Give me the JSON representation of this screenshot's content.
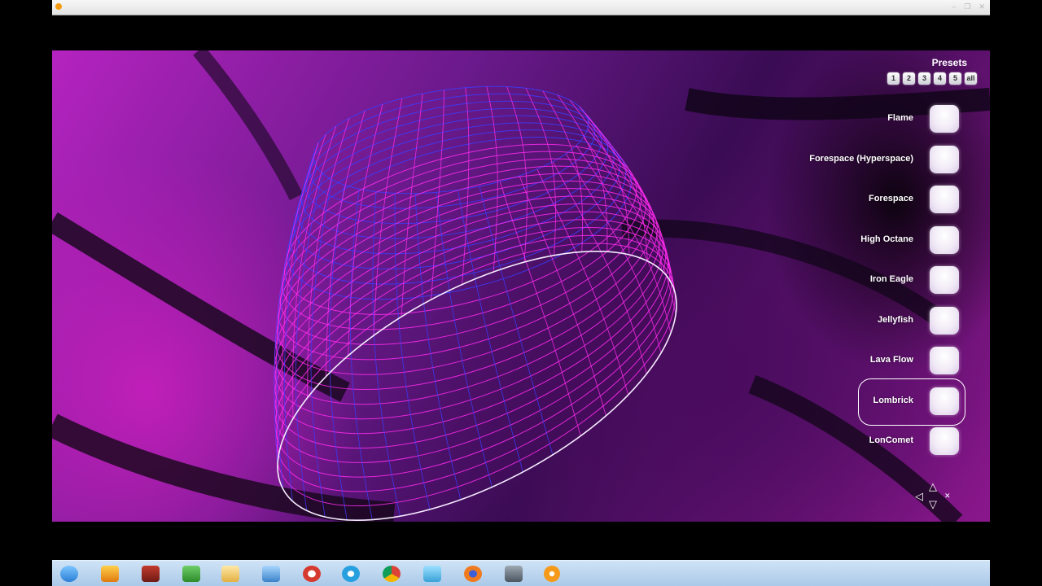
{
  "window": {
    "title": "",
    "control_glyphs": [
      "–",
      "❐",
      "✕"
    ]
  },
  "presets": {
    "title": "Presets",
    "numbers": [
      "1",
      "2",
      "3",
      "4",
      "5",
      "all"
    ],
    "items": [
      {
        "label": "Flame",
        "selected": false
      },
      {
        "label": "Forespace (Hyperspace)",
        "selected": false
      },
      {
        "label": "Forespace",
        "selected": false
      },
      {
        "label": "High Octane",
        "selected": false
      },
      {
        "label": "Iron Eagle",
        "selected": false
      },
      {
        "label": "Jellyfish",
        "selected": false
      },
      {
        "label": "Lava Flow",
        "selected": false
      },
      {
        "label": "Lombrick",
        "selected": true
      },
      {
        "label": "LonComet",
        "selected": false
      }
    ]
  },
  "navigation": {
    "left_arrow": "◁",
    "up_arrow": "△",
    "down_arrow": "▽",
    "close_glyph": "✕"
  },
  "taskbar": {
    "icons": [
      "start-orb-icon",
      "pen-icon",
      "app-icon",
      "recycle-icon",
      "folder-icon",
      "network-icon",
      "google-icon",
      "skype-icon",
      "chrome-icon",
      "pencil-tool-icon",
      "firefox-icon",
      "usb-icon",
      "media-player-icon"
    ]
  },
  "colors": {
    "wire_primary": "#ff2cf0",
    "wire_secondary": "#3b3dff",
    "rim": "#f2e6ff",
    "background_magenta": "#b523c0",
    "background_purple": "#3a0c54"
  }
}
